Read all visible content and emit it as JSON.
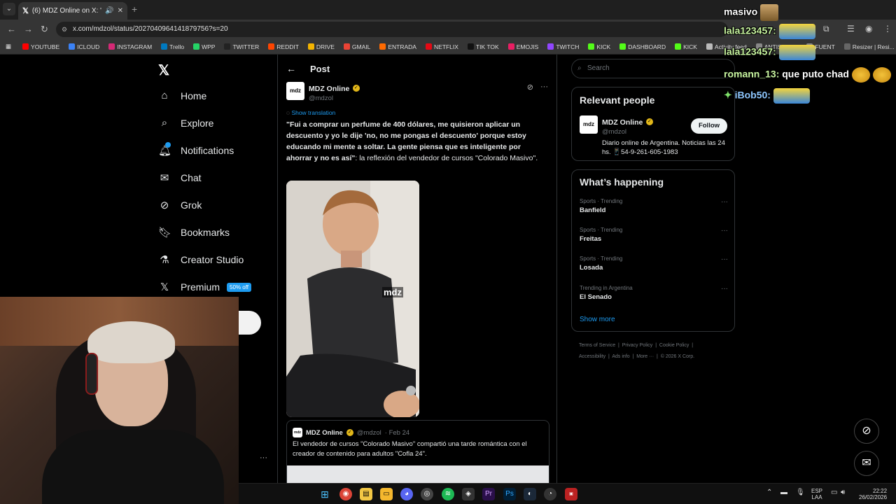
{
  "browser": {
    "tab_title": "(6) MDZ Online on X: \"\"Fui",
    "url": "x.com/mdzol/status/2027040964141879756?s=20",
    "bookmarks": [
      {
        "label": "YOUTUBE",
        "color": "#ff0000"
      },
      {
        "label": "ICLOUD",
        "color": "#3b82f6"
      },
      {
        "label": "INSTAGRAM",
        "color": "#d62976"
      },
      {
        "label": "Trello",
        "color": "#0079bf"
      },
      {
        "label": "WPP",
        "color": "#25d366"
      },
      {
        "label": "TWITTER",
        "color": "#222222"
      },
      {
        "label": "REDDIT",
        "color": "#ff4500"
      },
      {
        "label": "DRIVE",
        "color": "#f4b400"
      },
      {
        "label": "GMAIL",
        "color": "#ea4335"
      },
      {
        "label": "ENTRADA",
        "color": "#ff6a00"
      },
      {
        "label": "NETFLIX",
        "color": "#e50914"
      },
      {
        "label": "TIK TOK",
        "color": "#111111"
      },
      {
        "label": "EMOJIS",
        "color": "#e91e63"
      },
      {
        "label": "TWITCH",
        "color": "#9146ff"
      },
      {
        "label": "KICK",
        "color": "#53fc18"
      },
      {
        "label": "DASHBOARD",
        "color": "#53fc18"
      },
      {
        "label": "KICK",
        "color": "#53fc18"
      },
      {
        "label": "Activity feed",
        "color": "#bbbbbb"
      },
      {
        "label": "ANTISCUFF",
        "color": "#888888"
      },
      {
        "label": "FUENT",
        "color": "#888888"
      },
      {
        "label": "Resizer | Resi...",
        "color": "#666666"
      }
    ]
  },
  "sidebar": {
    "items": [
      {
        "label": "Home"
      },
      {
        "label": "Explore"
      },
      {
        "label": "Notifications"
      },
      {
        "label": "Chat"
      },
      {
        "label": "Grok"
      },
      {
        "label": "Bookmarks"
      },
      {
        "label": "Creator Studio"
      },
      {
        "label": "Premium"
      }
    ],
    "premium_badge": "50% off",
    "more": "···"
  },
  "post": {
    "header": "Post",
    "author_name": "MDZ Online",
    "author_handle": "@mdzol",
    "avatar_text": "mdz",
    "show_translation": "Show translation",
    "text_bold": "\"Fui a comprar un perfume de 400 dólares, me quisieron aplicar un descuento y yo le dije 'no, no me pongas el descuento' porque estoy educando mi mente a soltar. La gente piensa que es inteligente por ahorrar y no es así\"",
    "text_rest": ": la reflexión del vendedor de cursos \"Colorado Masivo\".",
    "video_watermark": "mdz",
    "quote": {
      "author_name": "MDZ Online",
      "author_handle": "@mdzol",
      "date": "· Feb 24",
      "text": "El vendedor de cursos \"Colorado Masivo\" compartió una tarde romántica con el creador de contenido para adultos \"Cofla 24\"."
    }
  },
  "right": {
    "search_placeholder": "Search",
    "relevant_title": "Relevant people",
    "person_name": "MDZ Online",
    "person_handle": "@mdzol",
    "person_bio": "Diario online de Argentina. Noticias las 24 hs. 📱54-9-261-605-1983",
    "follow_label": "Follow",
    "happening_title": "What’s happening",
    "trends": [
      {
        "category": "Sports · Trending",
        "name": "Banfield"
      },
      {
        "category": "Sports · Trending",
        "name": "Freitas"
      },
      {
        "category": "Sports · Trending",
        "name": "Losada"
      },
      {
        "category": "Trending in Argentina",
        "name": "El Senado"
      }
    ],
    "show_more": "Show more",
    "footer": [
      "Terms of Service",
      "Privacy Policy",
      "Cookie Policy",
      "Accessibility",
      "Ads info",
      "More ···",
      "© 2026 X Corp."
    ]
  },
  "chat": {
    "streamer": "masivo",
    "lines": [
      {
        "user": "lala123457:",
        "msg": ""
      },
      {
        "user": "lala123457:",
        "msg": ""
      },
      {
        "user": "romann_13:",
        "msg": " que puto chad"
      },
      {
        "user": "iBob50:",
        "msg": ""
      }
    ]
  },
  "taskbar": {
    "lang_top": "ESP",
    "lang_bottom": "LAA",
    "time": "22:22",
    "date": "26/02/2026"
  }
}
